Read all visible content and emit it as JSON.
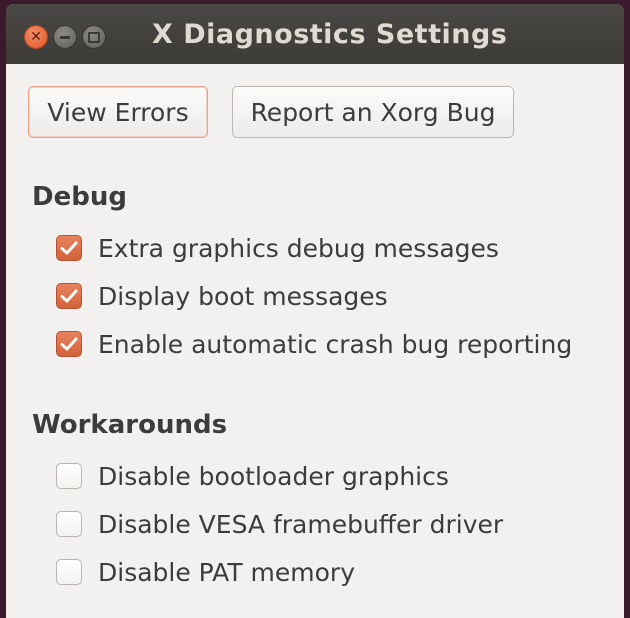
{
  "window": {
    "title": "X Diagnostics Settings"
  },
  "buttons": {
    "view_errors": "View Errors",
    "report_bug": "Report an Xorg Bug"
  },
  "debug": {
    "title": "Debug",
    "options": [
      {
        "label": "Extra graphics debug messages",
        "checked": true
      },
      {
        "label": "Display boot messages",
        "checked": true
      },
      {
        "label": "Enable automatic crash bug reporting",
        "checked": true
      }
    ]
  },
  "workarounds": {
    "title": "Workarounds",
    "options": [
      {
        "label": "Disable bootloader graphics",
        "checked": false
      },
      {
        "label": "Disable VESA framebuffer driver",
        "checked": false
      },
      {
        "label": "Disable PAT memory",
        "checked": false
      }
    ]
  },
  "colors": {
    "accent": "#dd6f47",
    "titlebar": "#3c3b37",
    "background": "#f2f1f0"
  }
}
